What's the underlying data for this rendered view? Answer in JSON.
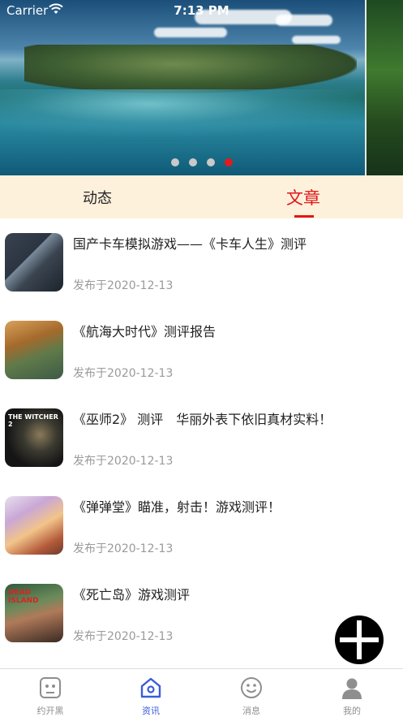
{
  "status_bar": {
    "carrier": "Carrier",
    "time": "7:13 PM"
  },
  "banner": {
    "dots_count": 4,
    "active_dot": 4
  },
  "tabs": [
    {
      "label": "动态",
      "active": false
    },
    {
      "label": "文章",
      "active": true
    }
  ],
  "articles": [
    {
      "title": "国产卡车模拟游戏——《卡车人生》测评",
      "date": "发布于2020-12-13",
      "thumb": "truck-sim"
    },
    {
      "title": "《航海大时代》测评报告",
      "date": "发布于2020-12-13",
      "thumb": "harbor-castle"
    },
    {
      "title": "《巫师2》 测评　华丽外表下依旧真材实料！",
      "date": "发布于2020-12-13",
      "thumb": "witcher",
      "thumb_text": "THE WITCHER 2"
    },
    {
      "title": "《弹弹堂》瞄准，射击！游戏测评！",
      "date": "发布于2020-12-13",
      "thumb": "ddtank"
    },
    {
      "title": "《死亡岛》游戏测评",
      "date": "发布于2020-12-13",
      "thumb": "dead-island",
      "thumb_text": "DEAD ISLAND"
    }
  ],
  "bottom_nav": [
    {
      "label": "约开黑",
      "icon": "robot-face-icon",
      "active": false
    },
    {
      "label": "资讯",
      "icon": "home-icon",
      "active": true
    },
    {
      "label": "消息",
      "icon": "smiley-icon",
      "active": false
    },
    {
      "label": "我的",
      "icon": "person-icon",
      "active": false
    }
  ],
  "colors": {
    "accent_red": "#e01717",
    "tab_bg": "#fdf1dc",
    "nav_active": "#3a5bd9",
    "nav_inactive": "#8e8e8e"
  }
}
